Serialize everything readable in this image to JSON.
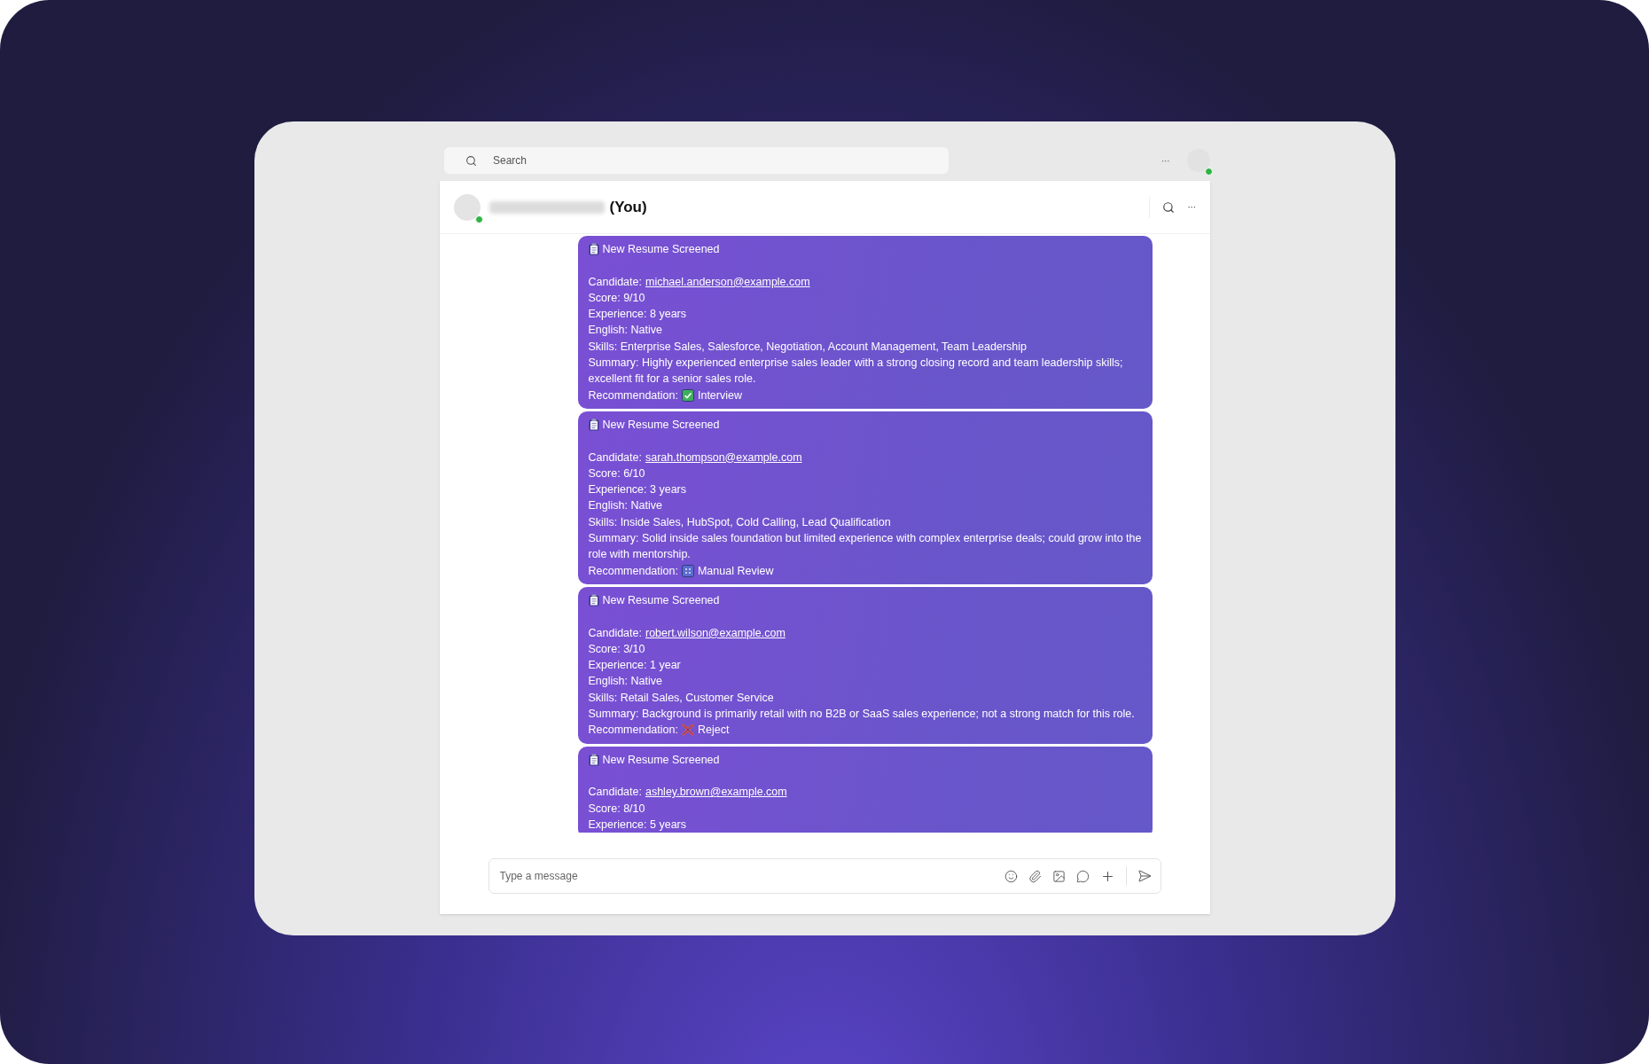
{
  "search": {
    "placeholder": "Search"
  },
  "top_bar": {
    "more": "···",
    "status_online": true
  },
  "chat_header": {
    "you_label": "(You)",
    "status_online": true,
    "more": "···"
  },
  "messages": [
    {
      "title": "New Resume Screened",
      "lines": [
        {
          "kind": "link",
          "label": "Candidate:",
          "value": "michael.anderson@example.com"
        },
        {
          "kind": "text",
          "label": "Score:",
          "value": "9/10"
        },
        {
          "kind": "text",
          "label": "Experience:",
          "value": "8 years"
        },
        {
          "kind": "text",
          "label": "English:",
          "value": "Native"
        },
        {
          "kind": "text",
          "label": "Skills:",
          "value": "Enterprise Sales, Salesforce, Negotiation, Account Management, Team Leadership"
        },
        {
          "kind": "text",
          "label": "Summary:",
          "value": "Highly experienced enterprise sales leader with a strong closing record and team leadership skills; excellent fit for a senior sales role."
        },
        {
          "kind": "accept",
          "label": "Recommendation:",
          "value": "Interview"
        }
      ]
    },
    {
      "title": "New Resume Screened",
      "lines": [
        {
          "kind": "link",
          "label": "Candidate:",
          "value": "sarah.thompson@example.com"
        },
        {
          "kind": "text",
          "label": "Score:",
          "value": "6/10"
        },
        {
          "kind": "text",
          "label": "Experience:",
          "value": "3 years"
        },
        {
          "kind": "text",
          "label": "English:",
          "value": "Native"
        },
        {
          "kind": "text",
          "label": "Skills:",
          "value": "Inside Sales, HubSpot, Cold Calling, Lead Qualification"
        },
        {
          "kind": "text",
          "label": "Summary:",
          "value": "Solid inside sales foundation but limited experience with complex enterprise deals; could grow into the role with mentorship."
        },
        {
          "kind": "review",
          "label": "Recommendation:",
          "value": "Manual Review"
        }
      ]
    },
    {
      "title": "New Resume Screened",
      "lines": [
        {
          "kind": "link",
          "label": "Candidate:",
          "value": "robert.wilson@example.com"
        },
        {
          "kind": "text",
          "label": "Score:",
          "value": "3/10"
        },
        {
          "kind": "text",
          "label": "Experience:",
          "value": "1 year"
        },
        {
          "kind": "text",
          "label": "English:",
          "value": "Native"
        },
        {
          "kind": "text",
          "label": "Skills:",
          "value": "Retail Sales, Customer Service"
        },
        {
          "kind": "text",
          "label": "Summary:",
          "value": "Background is primarily retail with no B2B or SaaS sales experience; not a strong match for this role."
        },
        {
          "kind": "reject",
          "label": "Recommendation:",
          "value": "Reject"
        }
      ]
    },
    {
      "title": "New Resume Screened",
      "lines": [
        {
          "kind": "link",
          "label": "Candidate:",
          "value": "ashley.brown@example.com"
        },
        {
          "kind": "text",
          "label": "Score:",
          "value": "8/10"
        },
        {
          "kind": "text",
          "label": "Experience:",
          "value": "5 years"
        }
      ]
    }
  ],
  "composer": {
    "placeholder": "Type a message"
  }
}
